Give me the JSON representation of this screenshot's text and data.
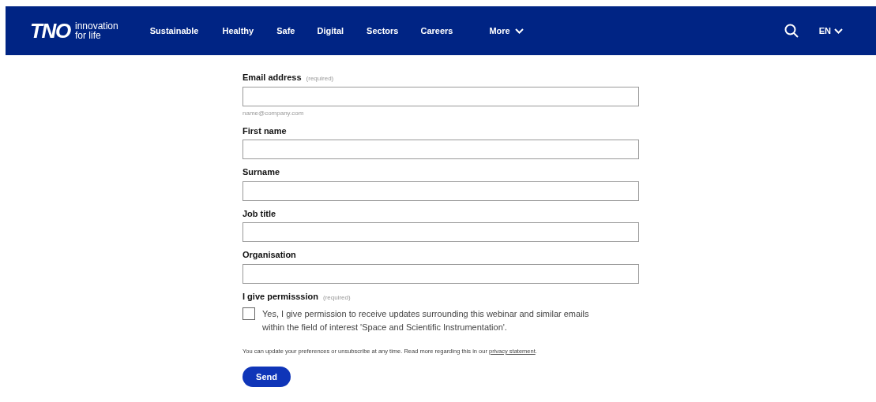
{
  "header": {
    "logo": "TNO",
    "tagline": [
      "innovation",
      "for life"
    ],
    "nav": [
      {
        "label": "Sustainable",
        "dropdown": false
      },
      {
        "label": "Healthy",
        "dropdown": false
      },
      {
        "label": "Safe",
        "dropdown": false
      },
      {
        "label": "Digital",
        "dropdown": false
      },
      {
        "label": "Sectors",
        "dropdown": false
      },
      {
        "label": "Careers",
        "dropdown": false
      },
      {
        "label": "More",
        "dropdown": true
      }
    ],
    "language": "EN"
  },
  "form": {
    "fields": [
      {
        "label": "Email address",
        "required": "(required)",
        "hint": "name@company.com"
      },
      {
        "label": "First name"
      },
      {
        "label": "Surname"
      },
      {
        "label": "Job title"
      },
      {
        "label": "Organisation"
      }
    ],
    "permission": {
      "label": "I give permisssion",
      "required": "(required)",
      "checked": false,
      "text": "Yes, I give permission to receive updates surrounding this webinar and similar emails within the field of interest 'Space and Scientific Instrumentation'."
    },
    "note": "You can update your preferences or unsubscribe at any time. Read more regarding this in our ",
    "note_link": "privacy statement",
    "note_end": ".",
    "submit": "Send"
  }
}
